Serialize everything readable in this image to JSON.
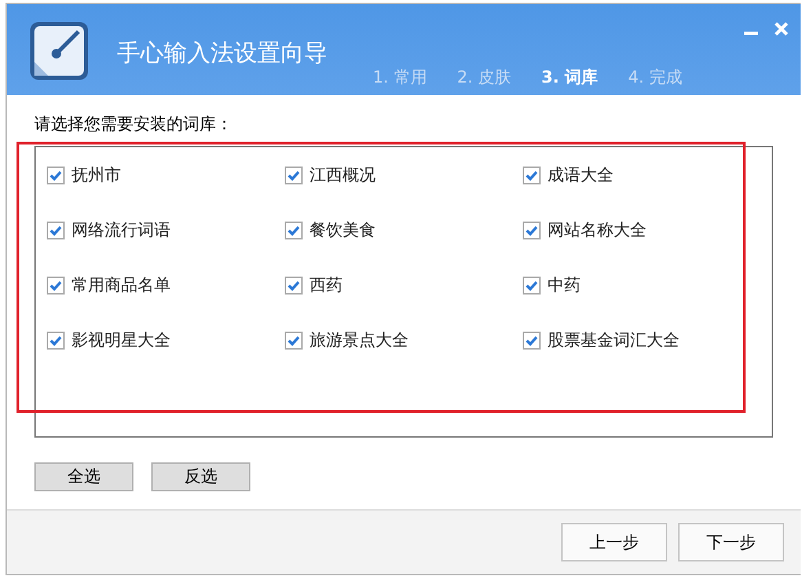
{
  "window": {
    "title": "手心输入法设置向导"
  },
  "steps": [
    {
      "label": "1. 常用",
      "selected": false
    },
    {
      "label": "2. 皮肤",
      "selected": false
    },
    {
      "label": "3. 词库",
      "selected": true
    },
    {
      "label": "4. 完成",
      "selected": false
    }
  ],
  "prompt": "请选择您需要安装的词库：",
  "dictionaries": [
    {
      "label": "抚州市",
      "checked": true
    },
    {
      "label": "江西概况",
      "checked": true
    },
    {
      "label": "成语大全",
      "checked": true
    },
    {
      "label": "网络流行词语",
      "checked": true
    },
    {
      "label": "餐饮美食",
      "checked": true
    },
    {
      "label": "网站名称大全",
      "checked": true
    },
    {
      "label": "常用商品名单",
      "checked": true
    },
    {
      "label": "西药",
      "checked": true
    },
    {
      "label": "中药",
      "checked": true
    },
    {
      "label": "影视明星大全",
      "checked": true
    },
    {
      "label": "旅游景点大全",
      "checked": true
    },
    {
      "label": "股票基金词汇大全",
      "checked": true
    }
  ],
  "selection_buttons": [
    "全选",
    "反选"
  ],
  "nav_buttons": [
    "上一步",
    "下一步"
  ]
}
